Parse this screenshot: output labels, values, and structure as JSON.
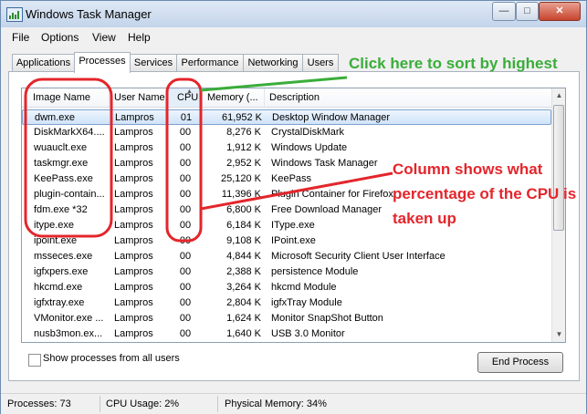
{
  "window": {
    "title": "Windows Task Manager",
    "min_glyph": "—",
    "max_glyph": "□",
    "close_glyph": "✕"
  },
  "menu": [
    "File",
    "Options",
    "View",
    "Help"
  ],
  "tabs": [
    "Applications",
    "Processes",
    "Services",
    "Performance",
    "Networking",
    "Users"
  ],
  "active_tab": "Processes",
  "columns": {
    "image_name": "Image Name",
    "user_name": "User Name",
    "cpu": "CPU",
    "memory": "Memory (...",
    "description": "Description"
  },
  "sort": {
    "column": "CPU",
    "arrow": "▲"
  },
  "processes": [
    {
      "image": "dwm.exe",
      "user": "Lampros",
      "cpu": "01",
      "mem": "61,952 K",
      "desc": "Desktop Window Manager"
    },
    {
      "image": "DiskMarkX64....",
      "user": "Lampros",
      "cpu": "00",
      "mem": "8,276 K",
      "desc": "CrystalDiskMark"
    },
    {
      "image": "wuauclt.exe",
      "user": "Lampros",
      "cpu": "00",
      "mem": "1,912 K",
      "desc": "Windows Update"
    },
    {
      "image": "taskmgr.exe",
      "user": "Lampros",
      "cpu": "00",
      "mem": "2,952 K",
      "desc": "Windows Task Manager"
    },
    {
      "image": "KeePass.exe",
      "user": "Lampros",
      "cpu": "00",
      "mem": "25,120 K",
      "desc": "KeePass"
    },
    {
      "image": "plugin-contain...",
      "user": "Lampros",
      "cpu": "00",
      "mem": "11,396 K",
      "desc": "Plugin Container for Firefox"
    },
    {
      "image": "fdm.exe *32",
      "user": "Lampros",
      "cpu": "00",
      "mem": "6,800 K",
      "desc": "Free Download Manager"
    },
    {
      "image": "itype.exe",
      "user": "Lampros",
      "cpu": "00",
      "mem": "6,184 K",
      "desc": "IType.exe"
    },
    {
      "image": "ipoint.exe",
      "user": "Lampros",
      "cpu": "00",
      "mem": "9,108 K",
      "desc": "IPoint.exe"
    },
    {
      "image": "msseces.exe",
      "user": "Lampros",
      "cpu": "00",
      "mem": "4,844 K",
      "desc": "Microsoft Security Client User Interface"
    },
    {
      "image": "igfxpers.exe",
      "user": "Lampros",
      "cpu": "00",
      "mem": "2,388 K",
      "desc": "persistence Module"
    },
    {
      "image": "hkcmd.exe",
      "user": "Lampros",
      "cpu": "00",
      "mem": "3,264 K",
      "desc": "hkcmd Module"
    },
    {
      "image": "igfxtray.exe",
      "user": "Lampros",
      "cpu": "00",
      "mem": "2,804 K",
      "desc": "igfxTray Module"
    },
    {
      "image": "VMonitor.exe ...",
      "user": "Lampros",
      "cpu": "00",
      "mem": "1,624 K",
      "desc": "Monitor SnapShot Button"
    },
    {
      "image": "nusb3mon.ex...",
      "user": "Lampros",
      "cpu": "00",
      "mem": "1,640 K",
      "desc": "USB 3.0 Monitor"
    }
  ],
  "show_all_processes": {
    "label": "Show processes from all users",
    "checked": false
  },
  "end_process_label": "End Process",
  "status": {
    "processes": "Processes: 73",
    "cpu_usage": "CPU Usage: 2%",
    "physical_memory": "Physical Memory: 34%"
  },
  "annotations": {
    "sort_hint": "Click here to sort by highest",
    "cpu_hint": "Column shows what percentage of the CPU is taken up"
  },
  "colors": {
    "annotation_green": "#3aad3a",
    "annotation_red": "#e3262c",
    "selection": "#cfe3f9"
  }
}
